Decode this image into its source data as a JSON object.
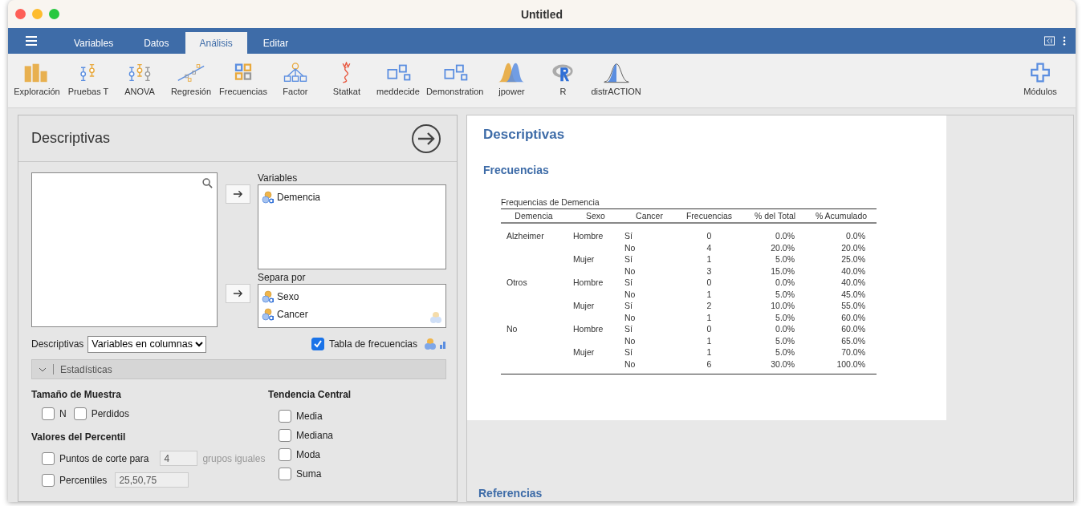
{
  "window": {
    "title": "Untitled"
  },
  "tabs": [
    {
      "label": "Variables",
      "selected": false
    },
    {
      "label": "Datos",
      "selected": false
    },
    {
      "label": "Análisis",
      "selected": true
    },
    {
      "label": "Editar",
      "selected": false
    }
  ],
  "ribbon": [
    {
      "label": "Exploración",
      "kind": "bars"
    },
    {
      "label": "Pruebas T",
      "kind": "ttest"
    },
    {
      "label": "ANOVA",
      "kind": "anova"
    },
    {
      "label": "Regresión",
      "kind": "regression"
    },
    {
      "label": "Frecuencias",
      "kind": "grid"
    },
    {
      "label": "Factor",
      "kind": "tree"
    },
    {
      "label": "Statkat",
      "kind": "squiggle"
    },
    {
      "label": "meddecide",
      "kind": "boxes"
    },
    {
      "label": "Demonstration",
      "kind": "boxes"
    },
    {
      "label": "jpower",
      "kind": "peaks"
    },
    {
      "label": "R",
      "kind": "r"
    },
    {
      "label": "distrACTION",
      "kind": "bell"
    }
  ],
  "modules_button": {
    "label": "Módulos"
  },
  "analysis": {
    "title": "Descriptivas",
    "variables": {
      "label": "Variables",
      "items": [
        "Demencia"
      ]
    },
    "split_by": {
      "label": "Separa por",
      "items": [
        "Sexo",
        "Cancer"
      ]
    },
    "layout": {
      "label": "Descriptivas",
      "value": "Variables en columnas"
    },
    "frequency_table": {
      "label": "Tabla de frecuencias",
      "checked": true
    },
    "section": {
      "label": "Estadísticas",
      "expanded": true
    },
    "sample_size": {
      "title": "Tamaño de Muestra",
      "options": [
        {
          "label": "N",
          "checked": false
        },
        {
          "label": "Perdidos",
          "checked": false
        }
      ]
    },
    "percentiles": {
      "title": "Valores del Percentil",
      "cut_points": {
        "label": "Puntos de corte para",
        "checked": false,
        "value": "4",
        "suffix": "grupos iguales"
      },
      "percentiles": {
        "label": "Percentiles",
        "checked": false,
        "value": "25,50,75"
      }
    },
    "central_tendency": {
      "title": "Tendencia Central",
      "options": [
        {
          "label": "Media",
          "checked": false
        },
        {
          "label": "Mediana",
          "checked": false
        },
        {
          "label": "Moda",
          "checked": false
        },
        {
          "label": "Suma",
          "checked": false
        }
      ]
    }
  },
  "results": {
    "title": "Descriptivas",
    "subtitle": "Frecuencias",
    "table": {
      "caption": "Frequencias de Demencia",
      "columns": [
        "Demencia",
        "Sexo",
        "Cancer",
        "Frecuencias",
        "% del Total",
        "% Acumulado"
      ],
      "rows": [
        {
          "demencia": "Alzheimer",
          "sexo": "Hombre",
          "cancer": "Sí",
          "n": "0",
          "pct": "0.0%",
          "cum": "0.0%"
        },
        {
          "cancer": "No",
          "n": "4",
          "pct": "20.0%",
          "cum": "20.0%"
        },
        {
          "sexo": "Mujer",
          "cancer": "Sí",
          "n": "1",
          "pct": "5.0%",
          "cum": "25.0%"
        },
        {
          "cancer": "No",
          "n": "3",
          "pct": "15.0%",
          "cum": "40.0%"
        },
        {
          "demencia": "Otros",
          "sexo": "Hombre",
          "cancer": "Sí",
          "n": "0",
          "pct": "0.0%",
          "cum": "40.0%"
        },
        {
          "cancer": "No",
          "n": "1",
          "pct": "5.0%",
          "cum": "45.0%"
        },
        {
          "sexo": "Mujer",
          "cancer": "Sí",
          "n": "2",
          "pct": "10.0%",
          "cum": "55.0%"
        },
        {
          "cancer": "No",
          "n": "1",
          "pct": "5.0%",
          "cum": "60.0%"
        },
        {
          "demencia": "No",
          "sexo": "Hombre",
          "cancer": "Sí",
          "n": "0",
          "pct": "0.0%",
          "cum": "60.0%"
        },
        {
          "cancer": "No",
          "n": "1",
          "pct": "5.0%",
          "cum": "65.0%"
        },
        {
          "sexo": "Mujer",
          "cancer": "Sí",
          "n": "1",
          "pct": "5.0%",
          "cum": "70.0%"
        },
        {
          "cancer": "No",
          "n": "6",
          "pct": "30.0%",
          "cum": "100.0%"
        }
      ]
    }
  },
  "references": {
    "title": "Referencias"
  }
}
